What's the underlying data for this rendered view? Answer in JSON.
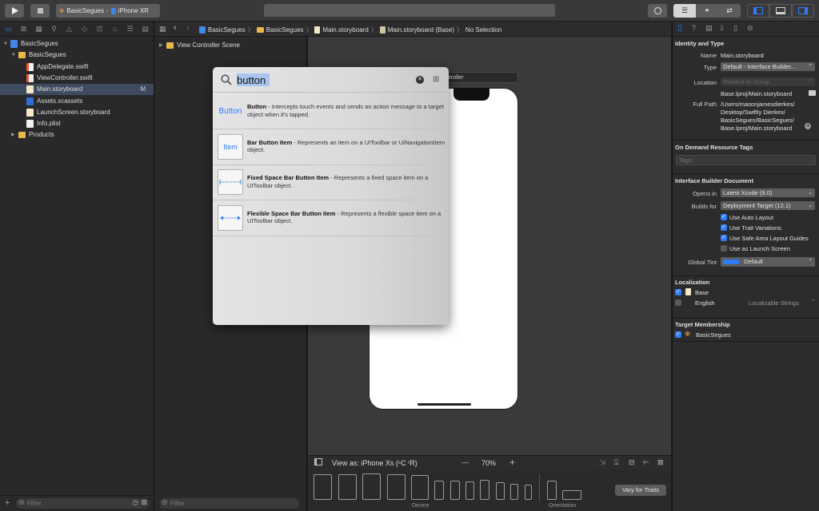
{
  "toolbar": {
    "scheme_name": "BasicSegues",
    "destination": "iPhone XR"
  },
  "navigator": {
    "items": [
      {
        "label": "BasicSegues",
        "kind": "proj",
        "indent": 0,
        "badge": ""
      },
      {
        "label": "BasicSegues",
        "kind": "folder",
        "indent": 1,
        "badge": ""
      },
      {
        "label": "AppDelegate.swift",
        "kind": "swift",
        "indent": 2,
        "badge": ""
      },
      {
        "label": "ViewController.swift",
        "kind": "swift",
        "indent": 2,
        "badge": ""
      },
      {
        "label": "Main.storyboard",
        "kind": "sb",
        "indent": 2,
        "badge": "M"
      },
      {
        "label": "Assets.xcassets",
        "kind": "assets",
        "indent": 2,
        "badge": ""
      },
      {
        "label": "LaunchScreen.storyboard",
        "kind": "sb",
        "indent": 2,
        "badge": ""
      },
      {
        "label": "Info.plist",
        "kind": "plist",
        "indent": 2,
        "badge": ""
      },
      {
        "label": "Products",
        "kind": "folder",
        "indent": 1,
        "badge": ""
      }
    ],
    "filter_placeholder": "Filter"
  },
  "outline": {
    "scene": "View Controller Scene",
    "filter_placeholder": "Filter"
  },
  "jumpbar": {
    "crumbs": [
      "BasicSegues",
      "BasicSegues",
      "Main.storyboard",
      "Main.storyboard (Base)",
      "No Selection"
    ]
  },
  "canvas": {
    "scene_label": "ntroller"
  },
  "bottombar": {
    "view_as": "View as: iPhone Xs (ᶜC ʳR)",
    "zoom": "70%",
    "minus": "—",
    "plus": "+",
    "device_label": "Device",
    "orientation_label": "Orientation",
    "vary_button": "Vary for Traits"
  },
  "library": {
    "query": "button",
    "items": [
      {
        "thumb": "Button",
        "title": "Button",
        "desc": " - Intercepts touch events and sends an action message to a target object when it's tapped."
      },
      {
        "thumb": "Item",
        "title": "Bar Button Item",
        "desc": " - Represents an item on a UIToolbar or UINavigationItem object."
      },
      {
        "thumb": "fixed",
        "title": "Fixed Space Bar Button Item",
        "desc": " - Represents a fixed space item on a UIToolbar object."
      },
      {
        "thumb": "flex",
        "title": "Flexible Space Bar Button Item",
        "desc": " - Represents a flexible space item on a UIToolbar object."
      }
    ]
  },
  "inspector": {
    "identity_title": "Identity and Type",
    "name_label": "Name",
    "name_value": "Main.storyboard",
    "type_label": "Type",
    "type_value": "Default - Interface Builder...",
    "location_label": "Location",
    "location_value": "Relative to Group",
    "location_path": "Base.lproj/Main.storyboard",
    "fullpath_label": "Full Path",
    "fullpath_lines": [
      "/Users/masonjamesdierkes/",
      "Desktop/Swiftly Dierkes/",
      "BasicSegues/BasicSegues/",
      "Base.lproj/Main.storyboard"
    ],
    "odr_title": "On Demand Resource Tags",
    "tags_placeholder": "Tags",
    "ibdoc_title": "Interface Builder Document",
    "opens_in_label": "Opens in",
    "opens_in_value": "Latest Xcode (9.0)",
    "builds_for_label": "Builds for",
    "builds_for_value": "Deployment Target (12.1)",
    "checks": [
      {
        "label": "Use Auto Layout",
        "on": true
      },
      {
        "label": "Use Trait Variations",
        "on": true
      },
      {
        "label": "Use Safe Area Layout Guides",
        "on": true
      },
      {
        "label": "Use as Launch Screen",
        "on": false
      }
    ],
    "global_tint_label": "Global Tint",
    "global_tint_value": "Default",
    "localization_title": "Localization",
    "loc_base": "Base",
    "loc_english": "English",
    "loc_english_value": "Localizable Strings",
    "membership_title": "Target Membership",
    "membership_target": "BasicSegues"
  },
  "colors": {
    "accent": "#2f7cf6",
    "selection": "#3e4a5e"
  }
}
